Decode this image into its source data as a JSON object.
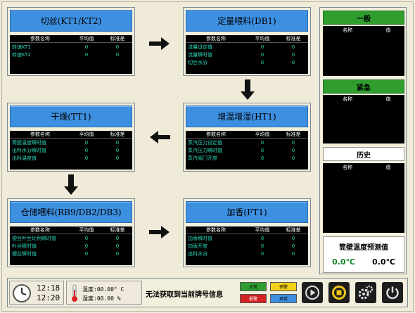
{
  "colors": {
    "title_blue": "#3d8fe0",
    "cell_cyan": "#2bd6b8",
    "green": "#2f9e2f",
    "yellow": "#f2d21a",
    "red": "#d42121",
    "blue_badge": "#3d8fe0"
  },
  "panels": {
    "cutting": {
      "title": "切丝(KT1/KT2)",
      "headers": [
        "参数名称",
        "平均值",
        "标准差"
      ],
      "rows": [
        {
          "name": "转速KT1",
          "avg": "0",
          "std": "0"
        },
        {
          "name": "转速KT2",
          "avg": "0",
          "std": "0"
        }
      ]
    },
    "storage_fixed": {
      "title": "定量喂料(DB1)",
      "headers": [
        "参数名称",
        "平均值",
        "标准差"
      ],
      "rows": [
        {
          "name": "流量设定值",
          "avg": "0",
          "std": "0"
        },
        {
          "name": "流量瞬时值",
          "avg": "0",
          "std": "0"
        },
        {
          "name": "切丝水分",
          "avg": "0",
          "std": "0"
        }
      ]
    },
    "drying": {
      "title": "干燥(TT1)",
      "headers": [
        "参数名称",
        "平均值",
        "标准差"
      ],
      "rows": [
        {
          "name": "筒壁温度瞬时值",
          "avg": "0",
          "std": "0"
        },
        {
          "name": "出料水分瞬时值",
          "avg": "0",
          "std": "0"
        },
        {
          "name": "出料温度值",
          "avg": "0",
          "std": "0"
        }
      ]
    },
    "humidify": {
      "title": "增温增湿(HT1)",
      "headers": [
        "参数名称",
        "平均值",
        "标准差"
      ],
      "rows": [
        {
          "name": "蒸汽压力设定值",
          "avg": "0",
          "std": "0"
        },
        {
          "name": "蒸汽压力瞬时值",
          "avg": "0",
          "std": "0"
        },
        {
          "name": "蒸汽阀门开度",
          "avg": "0",
          "std": "0"
        }
      ]
    },
    "storage": {
      "title": "仓储喂料(RB9/DB2/DB3)",
      "headers": [
        "参数名称",
        "平均值",
        "标准差"
      ],
      "rows": [
        {
          "name": "梗丝叶丝比例瞬时值",
          "avg": "0",
          "std": "0"
        },
        {
          "name": "叶丝瞬时值",
          "avg": "0",
          "std": "0"
        },
        {
          "name": "梗丝瞬时值",
          "avg": "0",
          "std": "0"
        }
      ]
    },
    "flavor": {
      "title": "加香(FT1)",
      "headers": [
        "参数名称",
        "平均值",
        "标准差"
      ],
      "rows": [
        {
          "name": "加香瞬时值",
          "avg": "0",
          "std": "0"
        },
        {
          "name": "加香开度",
          "avg": "0",
          "std": "0"
        },
        {
          "name": "出料水分",
          "avg": "0",
          "std": "0"
        }
      ]
    }
  },
  "side": {
    "general": {
      "title": "一般",
      "h1": "名称",
      "h2": "值"
    },
    "urgent": {
      "title": "紧急",
      "h1": "名称",
      "h2": "值"
    },
    "history": {
      "title": "历史",
      "h1": "名称",
      "h2": "值"
    },
    "predict": {
      "title": "筒壁温度预测值",
      "v1": "0.0℃",
      "v2": "0.0℃"
    }
  },
  "bottom": {
    "time1": "12:18",
    "time2": "12:20",
    "temp": "温度:00.00° C",
    "humidity": "湿度:00.00  %",
    "message": "无法获取到当前牌号信息",
    "badge_normal": "正常",
    "badge_warn": "预警",
    "badge_alarm": "报警",
    "badge_abnormal": "异常"
  },
  "icons": [
    "clock-icon",
    "thermometer-icon",
    "play-icon",
    "stop-icon",
    "settings-icon",
    "power-icon",
    "arrow-right-icon",
    "arrow-down-icon",
    "arrow-left-icon"
  ]
}
